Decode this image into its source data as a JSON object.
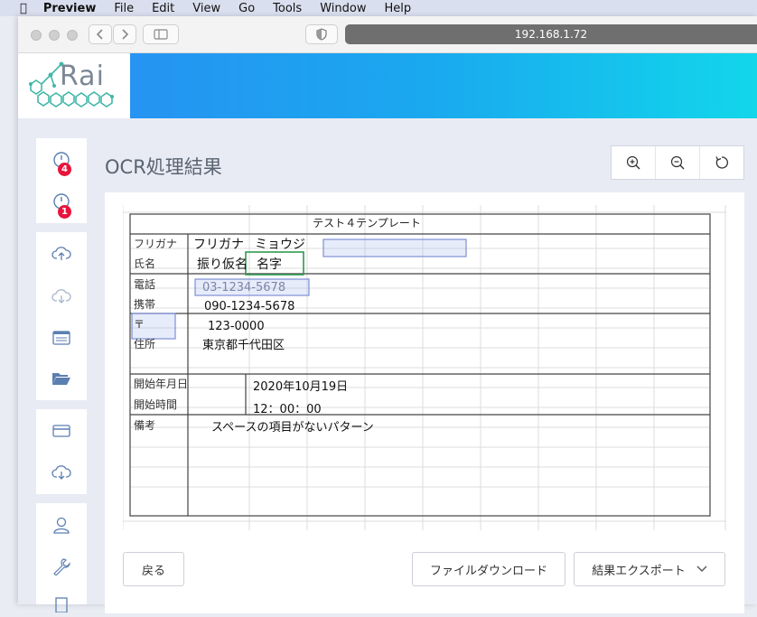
{
  "menubar": {
    "app_name": "Preview",
    "items": [
      "File",
      "Edit",
      "View",
      "Go",
      "Tools",
      "Window",
      "Help"
    ]
  },
  "browser": {
    "url": "192.168.1.72"
  },
  "header": {
    "logo_text": "Rai"
  },
  "sidebar": {
    "badge_1": "4",
    "badge_2": "1"
  },
  "page": {
    "title": "OCR処理結果"
  },
  "sheet": {
    "template_title": "テスト４テンプレート",
    "labels": {
      "furigana": "フリガナ",
      "name": "氏名",
      "phone": "電話",
      "mobile": "携帯",
      "postal": "〒",
      "address": "住所",
      "start_date": "開始年月日",
      "start_time": "開始時間",
      "notes": "備考"
    },
    "values": {
      "furigana_label": "フリガナ",
      "furigana_value": "ミョウジ",
      "name_label": "振り仮名",
      "name_value": "名字",
      "phone": "03-1234-5678",
      "mobile": "090-1234-5678",
      "postal": "123-0000",
      "address": "東京都千代田区",
      "start_date": "2020年10月19日",
      "start_time": "12：00：00",
      "notes": "スペースの項目がないパターン"
    }
  },
  "buttons": {
    "back": "戻る",
    "download": "ファイルダウンロード",
    "export": "結果エクスポート"
  }
}
